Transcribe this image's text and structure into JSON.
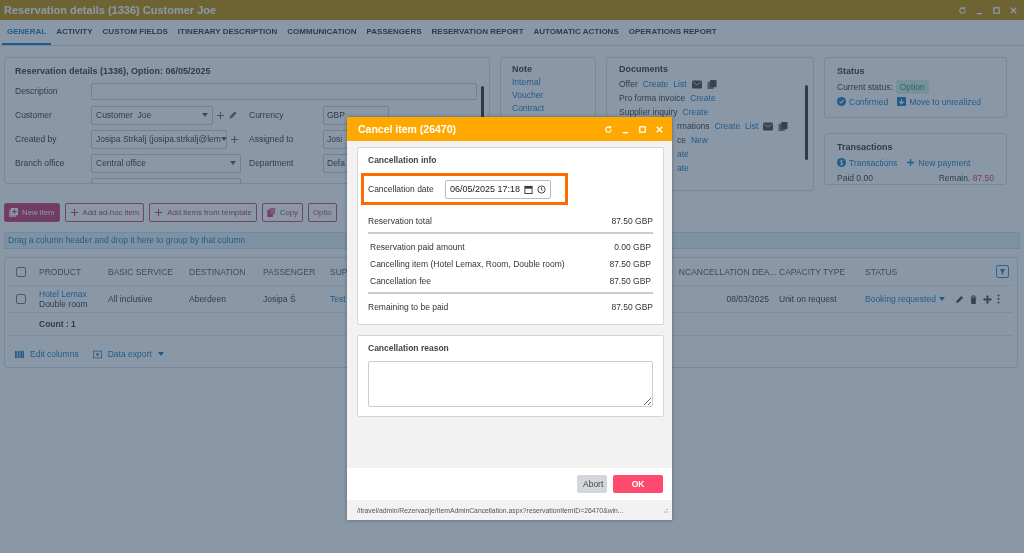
{
  "window": {
    "title": "Reservation details (1336) Customer Joe"
  },
  "tabs": [
    {
      "label": "GENERAL",
      "selected": true
    },
    {
      "label": "ACTIVITY",
      "selected": false
    },
    {
      "label": "CUSTOM FIELDS",
      "selected": false
    },
    {
      "label": "ITINERARY DESCRIPTION",
      "selected": false
    },
    {
      "label": "COMMUNICATION",
      "selected": false
    },
    {
      "label": "PASSENGERS",
      "selected": false
    },
    {
      "label": "RESERVATION REPORT",
      "selected": false
    },
    {
      "label": "AUTOMATIC ACTIONS",
      "selected": false
    },
    {
      "label": "OPERATIONS REPORT",
      "selected": false
    }
  ],
  "details": {
    "title": "Reservation details (1336), Option: 06/05/2025",
    "description_label": "Description",
    "rows": [
      {
        "left": {
          "label": "Customer",
          "value": "Customer  Joe",
          "actions": [
            {
              "kind": "add"
            },
            {
              "kind": "edit"
            }
          ]
        },
        "right": {
          "label": "Currency",
          "value": "GBP"
        }
      },
      {
        "left": {
          "label": "Created by",
          "value": "Josipa Strkalj (josipa.strkalj@lem",
          "actions": [
            {
              "kind": "add"
            }
          ]
        },
        "right": {
          "label": "Assigned to",
          "value": "Josi"
        }
      },
      {
        "left": {
          "label": "Branch office",
          "value": "Central office"
        },
        "right": {
          "label": "Department",
          "value": "Defa"
        }
      }
    ]
  },
  "note": {
    "title": "Note",
    "links": [
      "Internal",
      "Voucher",
      "Contract"
    ]
  },
  "documents": {
    "title": "Documents",
    "rows": [
      {
        "label": "Offer",
        "links": [
          "Create",
          "List"
        ],
        "kind": "icons",
        "cut": false
      },
      {
        "label": "Pro forma invoice",
        "links": [
          "Create"
        ],
        "kind": "plain",
        "cut": false
      },
      {
        "label": "Supplier inquiry",
        "links": [
          "Create"
        ],
        "kind": "plain",
        "cut": false
      },
      {
        "label": "rmations",
        "links": [
          "Create",
          "List"
        ],
        "kind": "icons",
        "cut": true
      },
      {
        "label": "ce",
        "links": [
          "New"
        ],
        "kind": "plain",
        "cut": true
      },
      {
        "links": [
          "ate"
        ],
        "kind": "plain",
        "cut": true
      },
      {
        "links": [
          "ate"
        ],
        "kind": "plain",
        "cut": true
      }
    ]
  },
  "status": {
    "title": "Status",
    "current_label": "Current status:",
    "current_value": "Option",
    "actions": [
      "Confirmed",
      "Move to unrealized"
    ]
  },
  "transactions": {
    "title": "Transactions",
    "links": [
      "Transactions",
      "New payment"
    ],
    "paid": "Paid 0.00",
    "remain_label": "Remain.",
    "remain_value": "87.50"
  },
  "toolbar": [
    {
      "label": "New item",
      "kind": "primary"
    },
    {
      "label": "Add ad-hoc item",
      "kind": "add"
    },
    {
      "label": "Add items from template",
      "kind": "add"
    },
    {
      "label": "Copy",
      "kind": "copy"
    },
    {
      "label": "Optio",
      "kind": "plain"
    }
  ],
  "group_hint": "Drag a column header and drop it here to group by that column",
  "table": {
    "header_checked": false,
    "columns": [
      "PRODUCT",
      "BASIC SERVICE",
      "DESTINATION",
      "PASSENGER",
      "SUP",
      "N",
      "CANCELLATION DEA...",
      "CAPACITY TYPE",
      "STATUS"
    ],
    "rows": [
      {
        "checked": false,
        "product": "Hotel Lemax",
        "room": "Double room",
        "basic_service": "All inclusive",
        "destination": "Aberdeen",
        "passenger": "Josipa Š",
        "supplier": "Test",
        "cancellation_deadline": "08/03/2025",
        "capacity_type": "Unit on request",
        "status": "Booking requested"
      }
    ],
    "count": "Count : 1"
  },
  "table_footer": [
    "Edit columns",
    "Data export"
  ],
  "dialog": {
    "title": "Cancel item (26470)",
    "info_title": "Cancellation info",
    "date_label": "Cancellation date",
    "date_value": "06/05/2025 17:18",
    "highlighted": true,
    "groups": [
      {
        "kind": "total",
        "lines": [
          {
            "label": "Reservation total",
            "amount": "87.50 GBP"
          }
        ]
      },
      {
        "kind": "detail",
        "lines": [
          {
            "label": "Reservation paid amount",
            "amount": "0.00 GBP"
          },
          {
            "label": "Cancelling item (Hotel Lemax, Room, Double room)",
            "amount": "87.50 GBP"
          },
          {
            "label": "Cancellation fee",
            "amount": "87.50 GBP"
          }
        ]
      },
      {
        "kind": "total",
        "lines": [
          {
            "label": "Remaining to be paid",
            "amount": "87.50 GBP"
          }
        ]
      }
    ],
    "reason_title": "Cancellation reason",
    "buttons": [
      {
        "label": "Abort",
        "kind": "secondary"
      },
      {
        "label": "OK",
        "kind": "primary"
      }
    ],
    "url": "/itravel/admin/Rezervacije/ItemAdminCancellation.aspx?reservationItemID=26470&win..."
  }
}
